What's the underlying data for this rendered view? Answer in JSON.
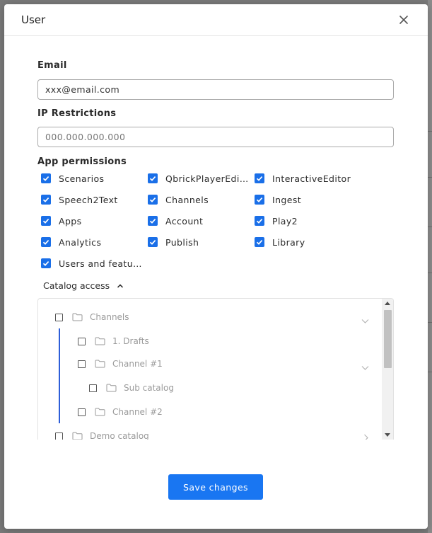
{
  "dialog": {
    "title": "User"
  },
  "email": {
    "label": "Email",
    "value": "xxx@email.com"
  },
  "ip": {
    "label": "IP Restrictions",
    "placeholder": "000.000.000.000"
  },
  "permissions": {
    "label": "App permissions",
    "items": [
      {
        "label": "Scenarios",
        "checked": true
      },
      {
        "label": "QbrickPlayerEditor",
        "checked": true
      },
      {
        "label": "InteractiveEditor",
        "checked": true
      },
      {
        "label": "Speech2Text",
        "checked": true
      },
      {
        "label": "Channels",
        "checked": true
      },
      {
        "label": "Ingest",
        "checked": true
      },
      {
        "label": "Apps",
        "checked": true
      },
      {
        "label": "Account",
        "checked": true
      },
      {
        "label": "Play2",
        "checked": true
      },
      {
        "label": "Analytics",
        "checked": true
      },
      {
        "label": "Publish",
        "checked": true
      },
      {
        "label": "Library",
        "checked": true
      },
      {
        "label": "Users and features",
        "checked": true
      }
    ]
  },
  "catalog": {
    "label": "Catalog access",
    "expanded": true,
    "tree": [
      {
        "label": "Channels",
        "depth": 0,
        "checked": false,
        "chevron": "down"
      },
      {
        "label": "1. Drafts",
        "depth": 1,
        "checked": false,
        "chevron": null
      },
      {
        "label": "Channel #1",
        "depth": 1,
        "checked": false,
        "chevron": "down"
      },
      {
        "label": "Sub catalog",
        "depth": 2,
        "checked": false,
        "chevron": null
      },
      {
        "label": "Channel #2",
        "depth": 1,
        "checked": false,
        "chevron": null
      },
      {
        "label": "Demo catalog",
        "depth": 0,
        "checked": false,
        "chevron": "right"
      }
    ]
  },
  "actions": {
    "save_label": "Save changes"
  },
  "colors": {
    "accent": "#1976f2",
    "checkbox": "#1a6fe8",
    "tree_guide": "#2d5ed8"
  },
  "icons": {
    "close": "close-icon",
    "checkmark": "checkmark-icon",
    "folder": "folder-icon",
    "chevron_up": "chevron-up-icon",
    "chevron_down": "chevron-down-icon",
    "chevron_right": "chevron-right-icon"
  }
}
